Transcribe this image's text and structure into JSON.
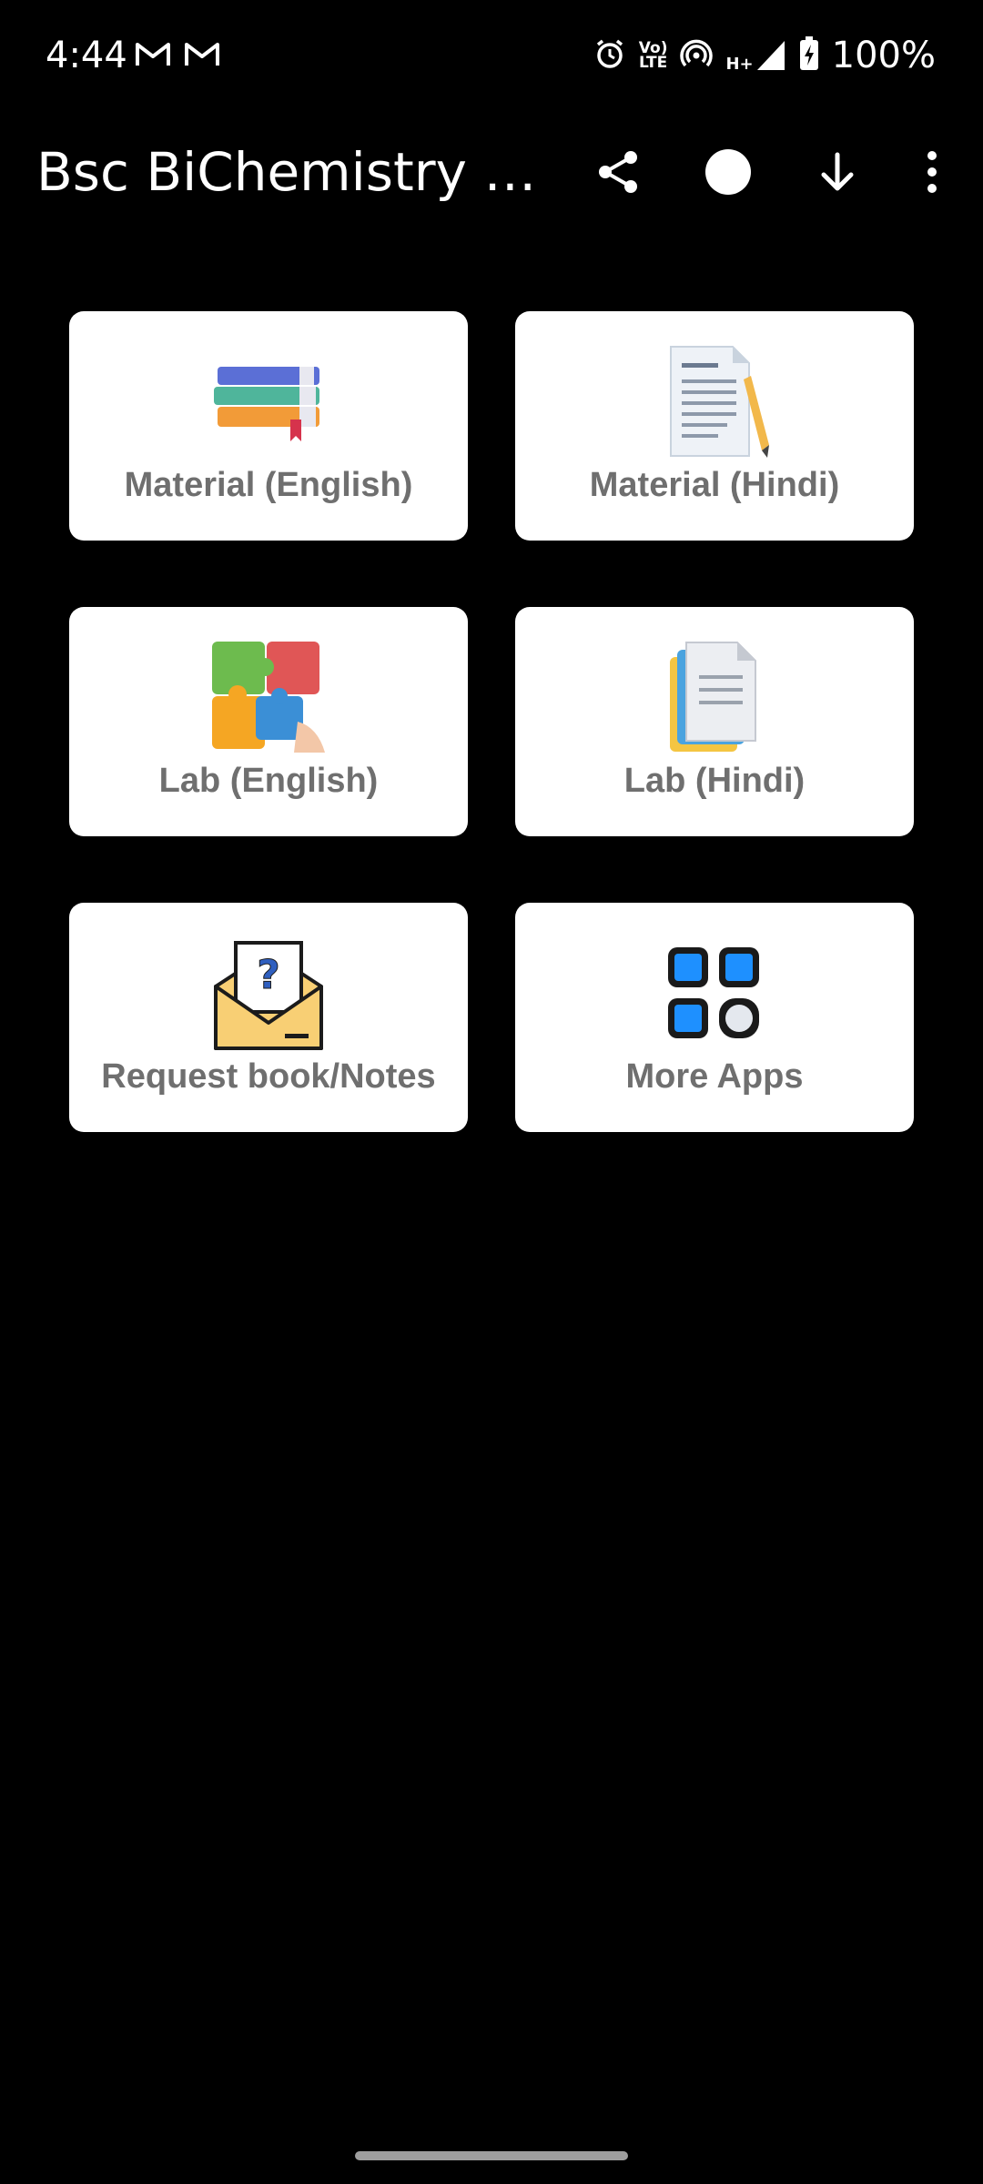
{
  "status_bar": {
    "time": "4:44",
    "network_top": "Vo)",
    "network_bottom": "LTE",
    "signal_type": "H+",
    "battery": "100%"
  },
  "app_bar": {
    "title": "Bsc BiChemistry N…",
    "icons": [
      "share-icon",
      "circle-icon",
      "download-icon",
      "more-vert-icon"
    ]
  },
  "grid": {
    "items": [
      {
        "label": "Material (English)",
        "icon": "books-icon"
      },
      {
        "label": "Material (Hindi)",
        "icon": "document-pencil-icon"
      },
      {
        "label": "Lab (English)",
        "icon": "puzzle-icon"
      },
      {
        "label": "Lab (Hindi)",
        "icon": "file-copy-icon"
      },
      {
        "label": "Request book/Notes",
        "icon": "envelope-question-icon"
      },
      {
        "label": "More Apps",
        "icon": "apps-grid-icon"
      }
    ]
  }
}
